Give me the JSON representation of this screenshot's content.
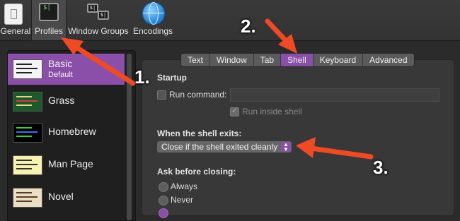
{
  "toolbar": {
    "items": [
      {
        "label": "General",
        "icon": "general-icon"
      },
      {
        "label": "Profiles",
        "icon": "terminal-icon",
        "icon_text": "$|",
        "selected": true
      },
      {
        "label": "Window Groups",
        "icon": "window-groups-icon",
        "icon_text_1": "$|",
        "icon_text_2": "$|"
      },
      {
        "label": "Encodings",
        "icon": "globe-icon"
      }
    ]
  },
  "sidebar": {
    "profiles": [
      {
        "name": "Basic",
        "subtitle": "Default",
        "selected": true,
        "thumb_bg": "#f4f4f4",
        "thumb_lines": [
          "#222",
          "#222",
          "#222"
        ]
      },
      {
        "name": "Grass",
        "thumb_bg": "#1c5a2c",
        "thumb_lines": [
          "#e8d28a",
          "#d04040",
          "#e8d28a"
        ]
      },
      {
        "name": "Homebrew",
        "thumb_bg": "#000000",
        "thumb_lines": [
          "#35d435",
          "#3a6cff",
          "#35d435"
        ]
      },
      {
        "name": "Man Page",
        "thumb_bg": "#f8f2b0",
        "thumb_lines": [
          "#333",
          "#333",
          "#333"
        ]
      },
      {
        "name": "Novel",
        "thumb_bg": "#eadfc3",
        "thumb_lines": [
          "#5b3b2a",
          "#5b3b2a",
          "#5b3b2a"
        ]
      }
    ]
  },
  "tabs": [
    {
      "label": "Text"
    },
    {
      "label": "Window"
    },
    {
      "label": "Tab"
    },
    {
      "label": "Shell",
      "selected": true
    },
    {
      "label": "Keyboard"
    },
    {
      "label": "Advanced"
    }
  ],
  "shell": {
    "startup_heading": "Startup",
    "run_command_label": "Run command:",
    "run_command_value": "",
    "run_command_checked": false,
    "run_inside_shell_label": "Run inside shell",
    "run_inside_shell_checked": true,
    "exit_heading": "When the shell exits:",
    "exit_option": "Close if the shell exited cleanly",
    "exit_stepper": "⌃⌄",
    "ask_heading": "Ask before closing:",
    "ask_options": [
      {
        "label": "Always",
        "selected": false
      },
      {
        "label": "Never",
        "selected": false
      }
    ]
  },
  "annotations": {
    "step1": "1.",
    "step2": "2.",
    "step3": "3.",
    "arrow_color": "#f04a24"
  },
  "colors": {
    "accent": "#8a4fa8",
    "background": "#2b2b2b"
  }
}
